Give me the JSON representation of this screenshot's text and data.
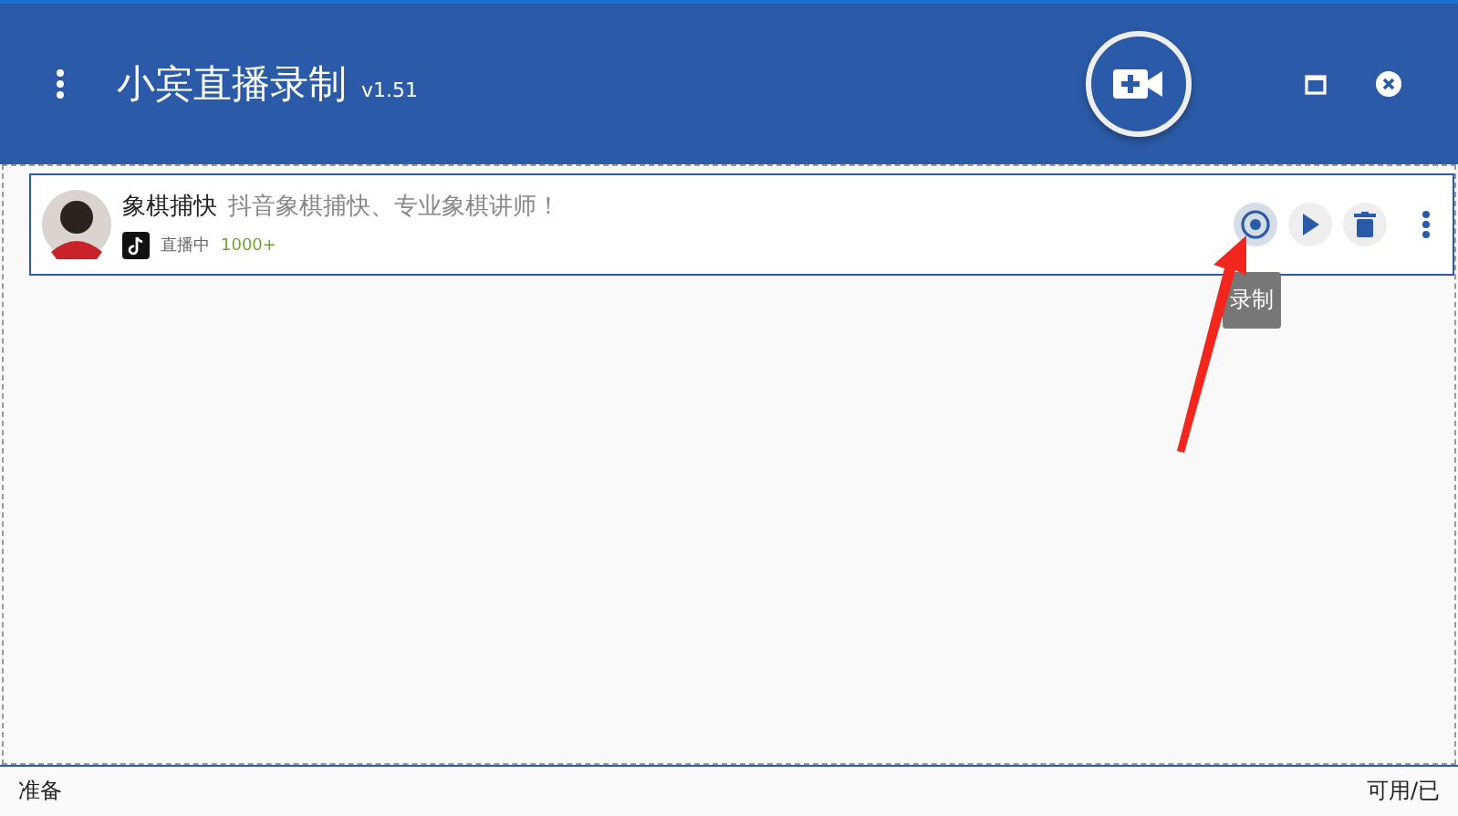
{
  "window": {
    "title": "小宾直播录制",
    "version": "v1.51"
  },
  "rooms": [
    {
      "name": "象棋捕快",
      "description": "抖音象棋捕快、专业象棋讲师！",
      "status": "直播中",
      "viewers": "1000+",
      "tooltip": "录制",
      "recording": false
    }
  ],
  "status_bar": {
    "left": "准备",
    "right": "可用/已"
  }
}
